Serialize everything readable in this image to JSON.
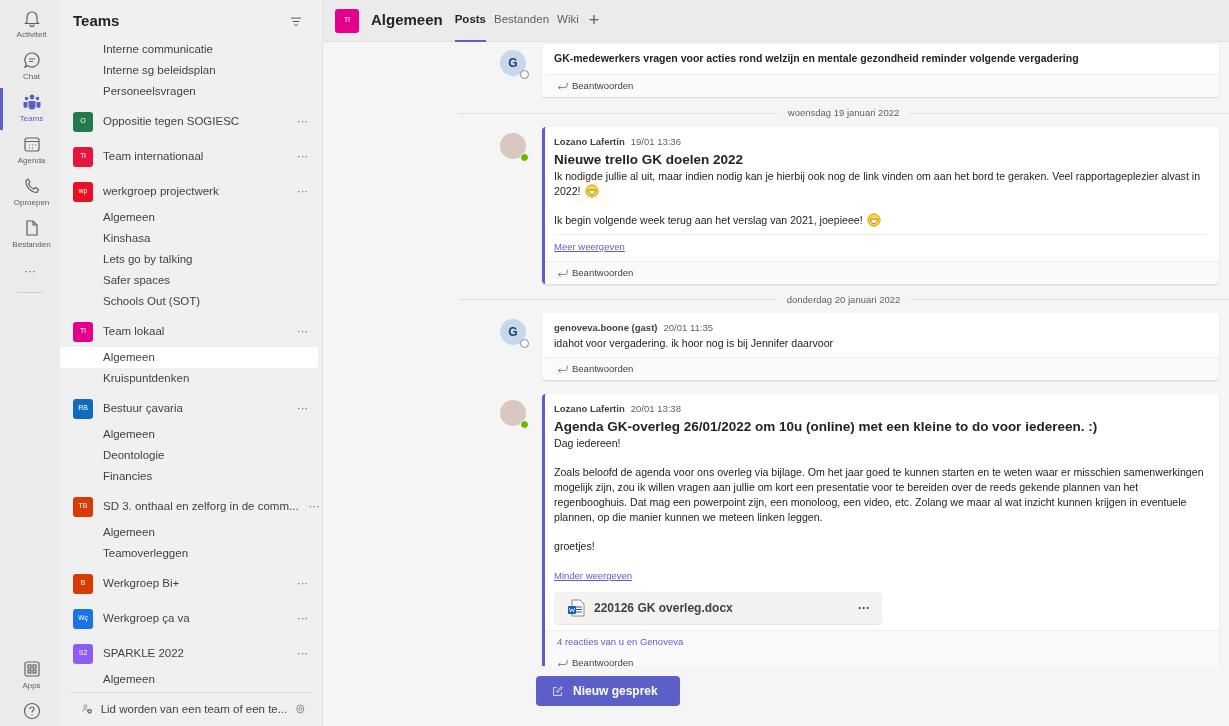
{
  "rail": {
    "items": [
      {
        "label": "Activiteit",
        "selected": false
      },
      {
        "label": "Chat",
        "selected": false
      },
      {
        "label": "Teams",
        "selected": true
      },
      {
        "label": "Agenda",
        "selected": false
      },
      {
        "label": "Oproepen",
        "selected": false
      },
      {
        "label": "Bestanden",
        "selected": false
      }
    ],
    "more": "···",
    "bottom": [
      {
        "label": "Apps",
        "selected": false
      },
      {
        "selected": false
      }
    ]
  },
  "sidebar": {
    "title": "Teams",
    "channels": [
      {
        "name": "Interne communicatie",
        "selected": false
      },
      {
        "name": "Interne sg beleidsplan",
        "selected": false
      },
      {
        "name": "Personeelsvragen",
        "selected": false
      }
    ],
    "teams": [
      {
        "name": "Oppositie tegen SOGIESC",
        "initials": "O",
        "color": "#237b4b"
      },
      {
        "name": "Team internationaal",
        "initials": "Ti",
        "color": "#e3173e"
      },
      {
        "name": "werkgroep projectwerk",
        "initials": "wp",
        "color": "#e81123",
        "channels": [
          {
            "name": "Algemeen",
            "selected": false
          },
          {
            "name": "Kinshasa",
            "selected": false
          },
          {
            "name": "Lets go by talking",
            "selected": false
          },
          {
            "name": "Safer spaces",
            "selected": false
          },
          {
            "name": "Schools Out (SOT)",
            "selected": false
          }
        ]
      },
      {
        "name": "Team lokaal",
        "initials": "Tl",
        "color": "#e3008c",
        "channels": [
          {
            "name": "Algemeen",
            "selected": true
          },
          {
            "name": "Kruispuntdenken",
            "selected": false
          }
        ]
      },
      {
        "name": "Bestuur çavaria",
        "initials": "RB",
        "color": "#0f6cbd",
        "channels": [
          {
            "name": "Algemeen",
            "selected": false
          },
          {
            "name": "Deontologie",
            "selected": false
          },
          {
            "name": "Financies",
            "selected": false
          }
        ]
      },
      {
        "name": "SD 3. onthaal en zelforg in de comm...",
        "initials": "TB",
        "color": "#d83b01",
        "channels": [
          {
            "name": "Algemeen",
            "selected": false
          },
          {
            "name": "Teamoverleggen",
            "selected": false
          }
        ]
      },
      {
        "name": "Werkgroep Bi+",
        "initials": "B",
        "color": "#d83b01"
      },
      {
        "name": "Werkgroep ça va",
        "initials": "Wç",
        "color": "#1a73e8"
      },
      {
        "name": "SPARKLE 2022",
        "initials": "S2",
        "color": "#8b5cf6",
        "channels": [
          {
            "name": "Algemeen",
            "selected": false
          }
        ]
      }
    ],
    "more": "···",
    "footer": "Lid worden van een team of een te..."
  },
  "header": {
    "initials": "Tl",
    "color": "#e3008c",
    "title": "Algemeen",
    "tabs": [
      {
        "label": "Posts",
        "selected": true
      },
      {
        "label": "Bestanden",
        "selected": false
      },
      {
        "label": "Wiki",
        "selected": false
      }
    ],
    "add": "+"
  },
  "feed": [
    {
      "kind": "message",
      "letter": "G",
      "online": false,
      "highlighted": false,
      "title": "GK-medewerkers vragen voor acties rond welzijn en mentale gezondheid reminder volgende vergadering",
      "reply": "Beantwoorden"
    },
    {
      "kind": "date",
      "text": "woensdag 19 januari 2022"
    },
    {
      "kind": "message",
      "online": true,
      "highlighted": true,
      "author": "Lozano Lafertin",
      "time": "19/01 13:36",
      "title": "Nieuwe trello GK doelen 2022",
      "paragraphs": [
        {
          "text": "Ik nodigde jullie al uit, maar indien nodig kan je hierbij ook nog de link vinden om aan het bord te geraken. Veel rapportageplezier alvast in 2022!",
          "emoji": true
        },
        {
          "text": "Ik begin volgende week terug aan het verslag van 2021, joepieee!",
          "emoji": true
        }
      ],
      "toggle": "Meer weergeven",
      "reply": "Beantwoorden"
    },
    {
      "kind": "date",
      "text": "donderdag 20 januari 2022"
    },
    {
      "kind": "message",
      "letter": "G",
      "online": false,
      "highlighted": false,
      "author": "genoveva.boone (gast)",
      "time": "20/01 11:35",
      "paragraphs": [
        {
          "text": "idahot voor vergadering. ik hoor nog is bij Jennifer daarvoor"
        }
      ],
      "reply": "Beantwoorden"
    },
    {
      "kind": "message",
      "online": true,
      "highlighted": true,
      "author": "Lozano Lafertin",
      "time": "20/01 13:38",
      "title": "Agenda GK-overleg 26/01/2022 om 10u (online) met een kleine to do voor iedereen. :)",
      "paragraphs": [
        {
          "text": "Dag iedereen!"
        },
        {
          "text": "Zoals beloofd de agenda voor ons overleg via bijlage. Om het jaar goed te kunnen starten en te weten waar er misschien samenwerkingen mogelijk zijn, zou ik willen vragen aan jullie om kort een presentatie voor te bereiden over de reeds gekende plannen van het regenbooghuis. Dat mag een powerpoint zijn, een monoloog, een video, etc. Zolang we maar al wat inzicht kunnen krijgen in eventuele plannen, op die manier kunnen we meteen linken leggen."
        },
        {
          "text": "groetjes!"
        }
      ],
      "toggle": "Minder weergeven",
      "attachment": {
        "name": "220126 GK overleg.docx",
        "more": "···"
      },
      "reactions": "4 reacties van u en Genoveva",
      "reply": "Beantwoorden"
    }
  ],
  "new_post": "Nieuw gesprek"
}
